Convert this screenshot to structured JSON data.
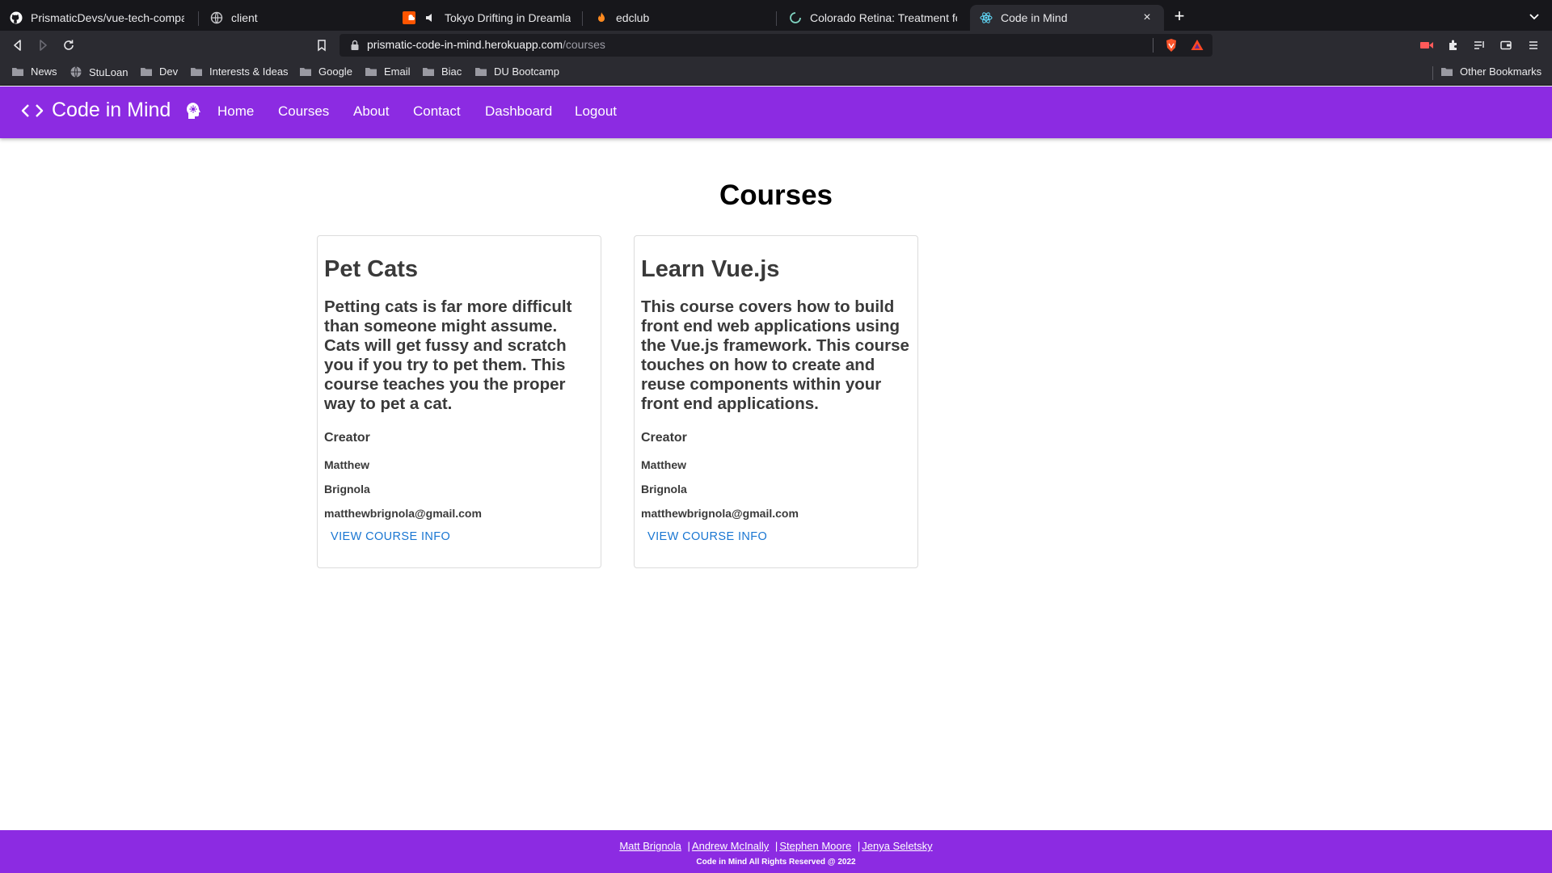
{
  "browser": {
    "tabs": [
      {
        "title": "PrismaticDevs/vue-tech-company",
        "favicon": "github-icon",
        "active": false
      },
      {
        "title": "client",
        "favicon": "globe-icon",
        "active": false
      },
      {
        "title": "Tokyo Drifting in Dreamland (+ B",
        "favicon": "soundcloud-icon",
        "active": false,
        "audio": true
      },
      {
        "title": "edclub",
        "favicon": "flame-icon",
        "active": false
      },
      {
        "title": "Colorado Retina: Treatment for Vitre",
        "favicon": "loading-icon",
        "active": false
      },
      {
        "title": "Code in Mind",
        "favicon": "vue-atom-icon",
        "active": true
      }
    ],
    "new_tab_label": "+",
    "url": {
      "host": "prismatic-code-in-mind.herokuapp.com",
      "path": "/courses"
    },
    "bookmarks": [
      {
        "label": "News",
        "icon": "folder-icon"
      },
      {
        "label": "StuLoan",
        "icon": "globe-icon"
      },
      {
        "label": "Dev",
        "icon": "folder-icon"
      },
      {
        "label": "Interests & Ideas",
        "icon": "folder-icon"
      },
      {
        "label": "Google",
        "icon": "folder-icon"
      },
      {
        "label": "Email",
        "icon": "folder-icon"
      },
      {
        "label": "Biac",
        "icon": "folder-icon"
      },
      {
        "label": "DU Bootcamp",
        "icon": "folder-icon"
      }
    ],
    "other_bookmarks": "Other Bookmarks"
  },
  "app": {
    "brand": "Code in Mind",
    "nav": [
      "Home",
      "Courses",
      "About",
      "Contact",
      "Dashboard",
      "Logout"
    ],
    "accent_color": "#8c2be2"
  },
  "page": {
    "title": "Courses"
  },
  "courses": [
    {
      "title": "Pet Cats",
      "description": "Petting cats is far more difficult than someone might assume. Cats will get fussy and scratch you if you try to pet them. This course teaches you the proper way to pet a cat.",
      "creator_label": "Creator",
      "creator_first": "Matthew",
      "creator_last": "Brignola",
      "creator_email": "matthewbrignola@gmail.com",
      "button": "VIEW COURSE INFO"
    },
    {
      "title": "Learn Vue.js",
      "description": "This course covers how to build front end web applications using the Vue.js framework. This course touches on how to create and reuse components within your front end applications.",
      "creator_label": "Creator",
      "creator_first": "Matthew",
      "creator_last": "Brignola",
      "creator_email": "matthewbrignola@gmail.com",
      "button": "VIEW COURSE INFO"
    }
  ],
  "footer": {
    "authors": [
      "Matt Brignola",
      "Andrew McInally",
      "Stephen Moore",
      "Jenya Seletsky"
    ],
    "pipe": "|",
    "copyright": "Code in Mind All Rights Reserved @ 2022"
  }
}
